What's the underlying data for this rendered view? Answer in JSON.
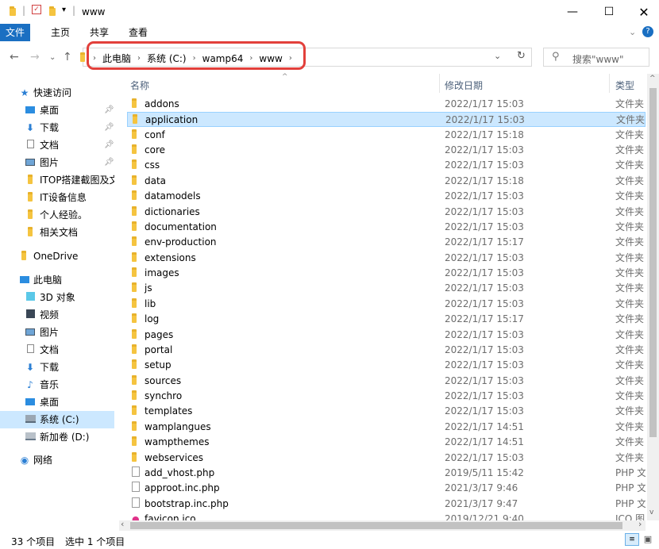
{
  "window": {
    "title": "www"
  },
  "ribbon": {
    "tabs": [
      "文件",
      "主页",
      "共享",
      "查看"
    ]
  },
  "address": {
    "crumbs": [
      "此电脑",
      "系统 (C:)",
      "wamp64",
      "www"
    ],
    "search_placeholder": "搜索\"www\""
  },
  "columns": {
    "name": "名称",
    "date": "修改日期",
    "type": "类型"
  },
  "nav": {
    "quick_access": "快速访问",
    "items": [
      {
        "label": "桌面",
        "icon": "desktop-icon",
        "pinned": true
      },
      {
        "label": "下载",
        "icon": "download-icon",
        "pinned": true
      },
      {
        "label": "文档",
        "icon": "document-icon",
        "pinned": true
      },
      {
        "label": "图片",
        "icon": "picture-icon",
        "pinned": true
      },
      {
        "label": "ITOP搭建截图及文档",
        "icon": "folder-icon",
        "pinned": false
      },
      {
        "label": "IT设备信息",
        "icon": "folder-icon",
        "pinned": false
      },
      {
        "label": "个人经验。",
        "icon": "folder-icon",
        "pinned": false
      },
      {
        "label": "相关文档",
        "icon": "folder-icon",
        "pinned": false
      }
    ],
    "onedrive": "OneDrive",
    "this_pc": "此电脑",
    "pc_items": [
      {
        "label": "3D 对象",
        "icon": "3d-objects-icon"
      },
      {
        "label": "视频",
        "icon": "video-icon"
      },
      {
        "label": "图片",
        "icon": "picture-icon"
      },
      {
        "label": "文档",
        "icon": "document-icon"
      },
      {
        "label": "下载",
        "icon": "download-icon"
      },
      {
        "label": "音乐",
        "icon": "music-icon"
      },
      {
        "label": "桌面",
        "icon": "desktop-icon"
      },
      {
        "label": "系统 (C:)",
        "icon": "drive-c-icon"
      },
      {
        "label": "新加卷 (D:)",
        "icon": "drive-d-icon"
      }
    ],
    "network": "网络"
  },
  "files": [
    {
      "name": "addons",
      "date": "2022/1/17 15:03",
      "type": "文件夹",
      "kind": "folder"
    },
    {
      "name": "application",
      "date": "2022/1/17 15:03",
      "type": "文件夹",
      "kind": "folder"
    },
    {
      "name": "conf",
      "date": "2022/1/17 15:18",
      "type": "文件夹",
      "kind": "folder"
    },
    {
      "name": "core",
      "date": "2022/1/17 15:03",
      "type": "文件夹",
      "kind": "folder"
    },
    {
      "name": "css",
      "date": "2022/1/17 15:03",
      "type": "文件夹",
      "kind": "folder"
    },
    {
      "name": "data",
      "date": "2022/1/17 15:18",
      "type": "文件夹",
      "kind": "folder"
    },
    {
      "name": "datamodels",
      "date": "2022/1/17 15:03",
      "type": "文件夹",
      "kind": "folder"
    },
    {
      "name": "dictionaries",
      "date": "2022/1/17 15:03",
      "type": "文件夹",
      "kind": "folder"
    },
    {
      "name": "documentation",
      "date": "2022/1/17 15:03",
      "type": "文件夹",
      "kind": "folder"
    },
    {
      "name": "env-production",
      "date": "2022/1/17 15:17",
      "type": "文件夹",
      "kind": "folder"
    },
    {
      "name": "extensions",
      "date": "2022/1/17 15:03",
      "type": "文件夹",
      "kind": "folder"
    },
    {
      "name": "images",
      "date": "2022/1/17 15:03",
      "type": "文件夹",
      "kind": "folder"
    },
    {
      "name": "js",
      "date": "2022/1/17 15:03",
      "type": "文件夹",
      "kind": "folder"
    },
    {
      "name": "lib",
      "date": "2022/1/17 15:03",
      "type": "文件夹",
      "kind": "folder"
    },
    {
      "name": "log",
      "date": "2022/1/17 15:17",
      "type": "文件夹",
      "kind": "folder"
    },
    {
      "name": "pages",
      "date": "2022/1/17 15:03",
      "type": "文件夹",
      "kind": "folder"
    },
    {
      "name": "portal",
      "date": "2022/1/17 15:03",
      "type": "文件夹",
      "kind": "folder"
    },
    {
      "name": "setup",
      "date": "2022/1/17 15:03",
      "type": "文件夹",
      "kind": "folder"
    },
    {
      "name": "sources",
      "date": "2022/1/17 15:03",
      "type": "文件夹",
      "kind": "folder"
    },
    {
      "name": "synchro",
      "date": "2022/1/17 15:03",
      "type": "文件夹",
      "kind": "folder"
    },
    {
      "name": "templates",
      "date": "2022/1/17 15:03",
      "type": "文件夹",
      "kind": "folder"
    },
    {
      "name": "wamplangues",
      "date": "2022/1/17 14:51",
      "type": "文件夹",
      "kind": "folder"
    },
    {
      "name": "wampthemes",
      "date": "2022/1/17 14:51",
      "type": "文件夹",
      "kind": "folder"
    },
    {
      "name": "webservices",
      "date": "2022/1/17 15:03",
      "type": "文件夹",
      "kind": "folder"
    },
    {
      "name": "add_vhost.php",
      "date": "2019/5/11 15:42",
      "type": "PHP 文件",
      "kind": "file"
    },
    {
      "name": "approot.inc.php",
      "date": "2021/3/17 9:46",
      "type": "PHP 文件",
      "kind": "file"
    },
    {
      "name": "bootstrap.inc.php",
      "date": "2021/3/17 9:47",
      "type": "PHP 文件",
      "kind": "file"
    },
    {
      "name": "favicon.ico",
      "date": "2019/12/21 9:40",
      "type": "ICO 图片",
      "kind": "ico"
    }
  ],
  "selected_file": "application",
  "status": {
    "count": "33 个项目",
    "selected": "选中 1 个项目"
  }
}
